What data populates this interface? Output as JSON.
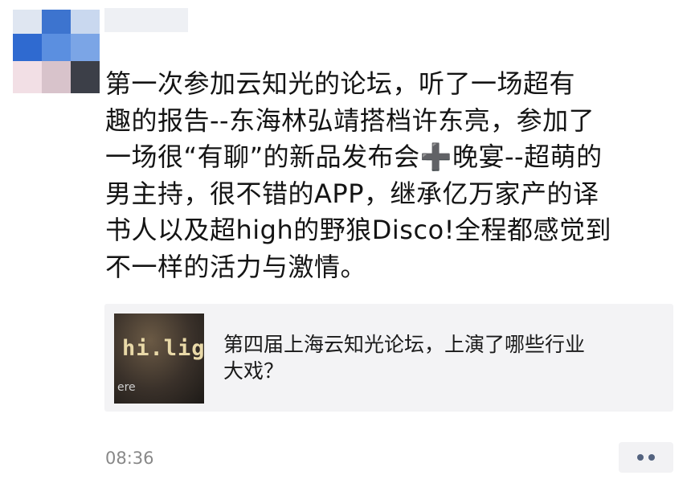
{
  "post": {
    "text": "第一次参加云知光的论坛，听了一场超有\n趣的报告--东海林弘靖搭档许东亮，参加了\n一场很“有聊”的新品发布会➕晚宴--超萌的\n男主持，很不错的APP，继承亿万家产的译\n书人以及超high的野狼Disco!全程都感觉到\n不一样的活力与激情。",
    "link": {
      "title": "第四届上海云知光论坛，上演了哪些行业\n大戏？",
      "thumbnail_logo": "hi.light",
      "thumbnail_fragment": "ere"
    },
    "time": "08:36"
  },
  "icons": {
    "avatar": "blurred-avatar",
    "more": "more-dots-icon"
  }
}
